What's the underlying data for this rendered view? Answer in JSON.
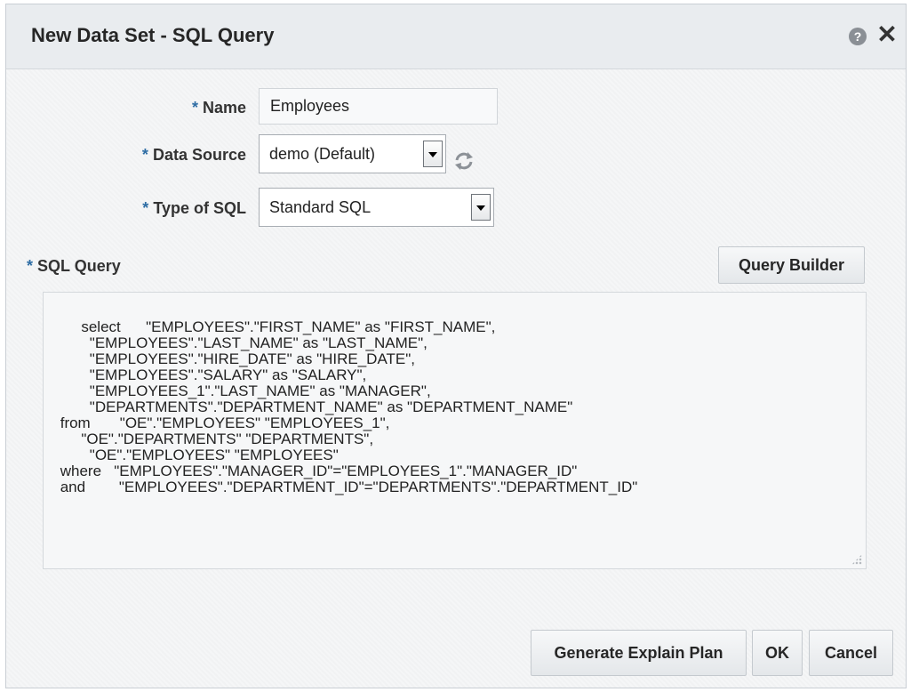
{
  "dialog": {
    "title": "New Data Set - SQL Query",
    "help_icon": "help-icon",
    "close_icon": "close-icon",
    "close_glyph": "✕"
  },
  "form": {
    "required_mark": "*",
    "name": {
      "label": "Name",
      "value": "Employees"
    },
    "data_source": {
      "label": "Data Source",
      "value": "demo (Default)",
      "refresh_icon": "refresh-icon"
    },
    "type_of_sql": {
      "label": "Type of SQL",
      "value": "Standard SQL"
    },
    "sql_query": {
      "label": "SQL Query",
      "query_builder_label": "Query Builder",
      "text": "select      \"EMPLOYEES\".\"FIRST_NAME\" as \"FIRST_NAME\",\n        \"EMPLOYEES\".\"LAST_NAME\" as \"LAST_NAME\",\n        \"EMPLOYEES\".\"HIRE_DATE\" as \"HIRE_DATE\",\n        \"EMPLOYEES\".\"SALARY\" as \"SALARY\",\n        \"EMPLOYEES_1\".\"LAST_NAME\" as \"MANAGER\",\n        \"DEPARTMENTS\".\"DEPARTMENT_NAME\" as \"DEPARTMENT_NAME\"\n from       \"OE\".\"EMPLOYEES\" \"EMPLOYEES_1\",\n      \"OE\".\"DEPARTMENTS\" \"DEPARTMENTS\",\n        \"OE\".\"EMPLOYEES\" \"EMPLOYEES\"\n where   \"EMPLOYEES\".\"MANAGER_ID\"=\"EMPLOYEES_1\".\"MANAGER_ID\"\n and        \"EMPLOYEES\".\"DEPARTMENT_ID\"=\"DEPARTMENTS\".\"DEPARTMENT_ID\""
    }
  },
  "footer": {
    "generate_explain_plan_label": "Generate Explain Plan",
    "ok_label": "OK",
    "cancel_label": "Cancel"
  },
  "colors": {
    "required": "#2e6da4",
    "title_bar": "#e9ecef",
    "background": "#f3f4f5"
  }
}
